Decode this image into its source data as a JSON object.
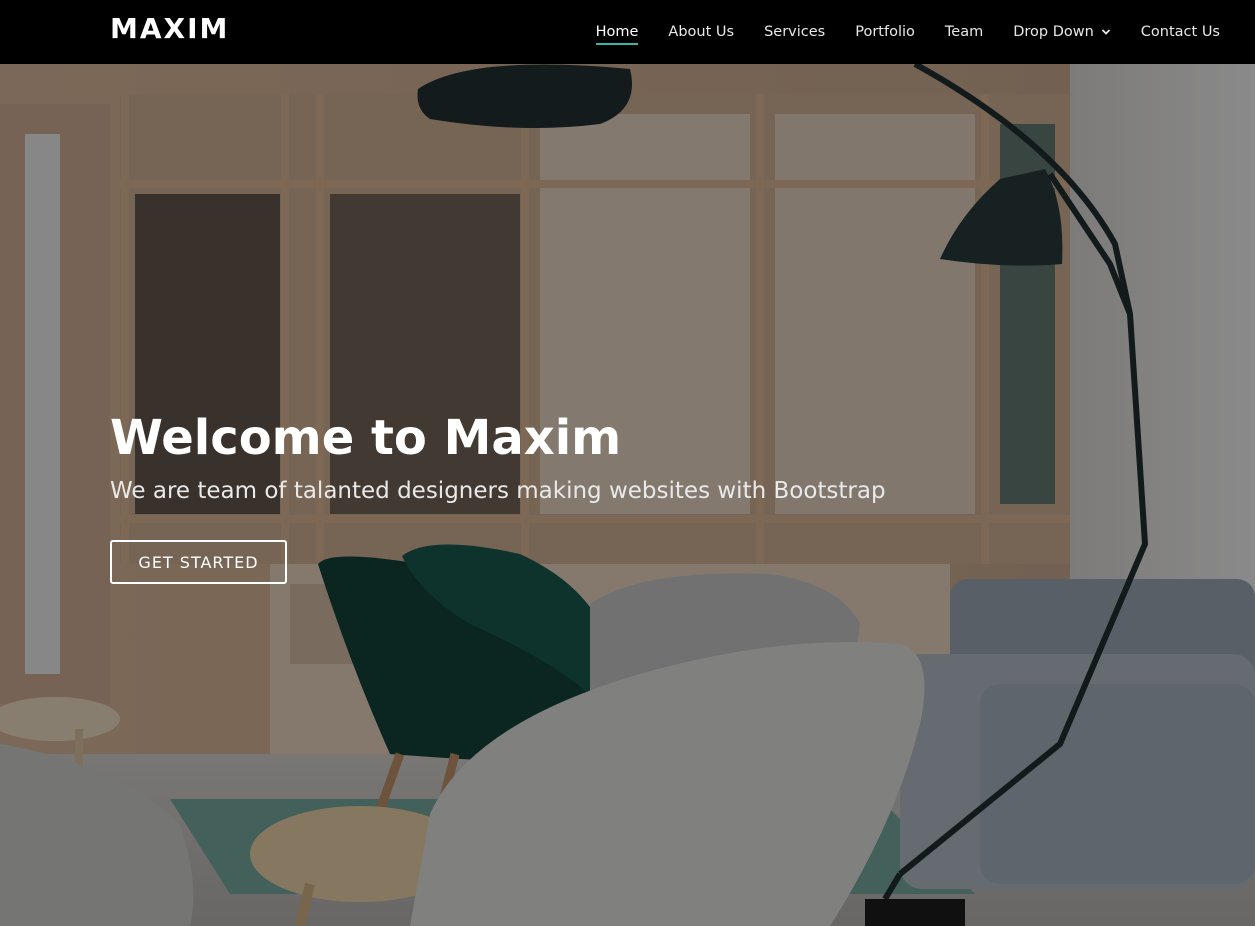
{
  "brand": {
    "logo_text": "MAXIM"
  },
  "nav": {
    "items": [
      {
        "label": "Home",
        "active": true
      },
      {
        "label": "About Us"
      },
      {
        "label": "Services"
      },
      {
        "label": "Portfolio"
      },
      {
        "label": "Team"
      },
      {
        "label": "Drop Down",
        "icon": "chevron-down-icon"
      },
      {
        "label": "Contact Us"
      }
    ]
  },
  "hero": {
    "title": "Welcome to Maxim",
    "subtitle": "We are team of talanted designers making websites with Bootstrap",
    "cta_label": "GET STARTED"
  },
  "colors": {
    "accent": "#34b7a7",
    "header_bg": "#000000",
    "text": "#ffffff"
  }
}
